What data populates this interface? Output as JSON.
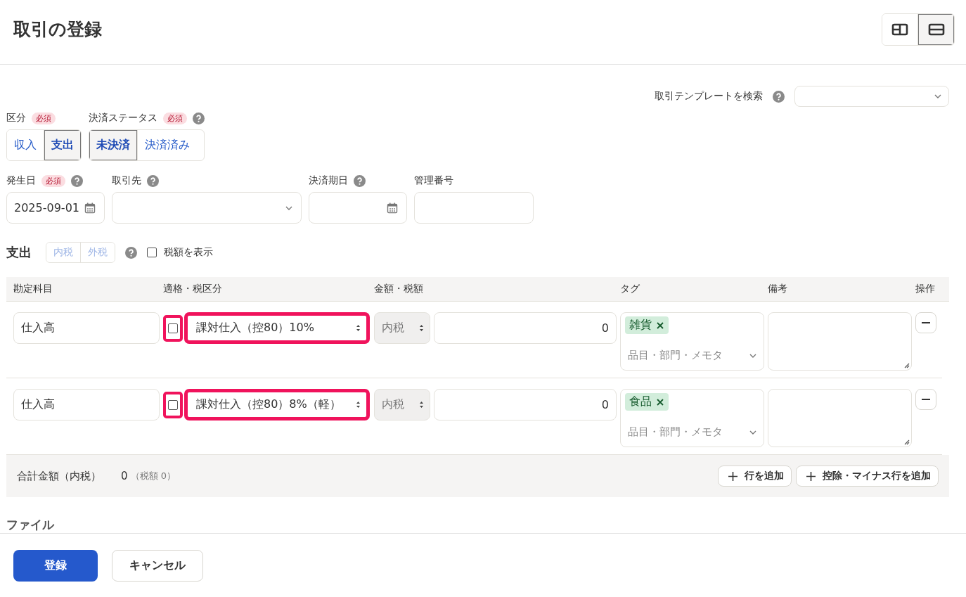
{
  "title": "取引の登録",
  "layout_toggle": [
    {
      "kind": "split",
      "selected": false
    },
    {
      "kind": "stacked",
      "selected": true
    }
  ],
  "template_search": {
    "label": "取引テンプレートを検索"
  },
  "category": {
    "label": "区分",
    "required": "必須",
    "options": [
      {
        "label": "収入",
        "selected": false
      },
      {
        "label": "支出",
        "selected": true
      }
    ]
  },
  "settlement": {
    "label": "決済ステータス",
    "required": "必須",
    "options": [
      {
        "label": "未決済",
        "selected": true
      },
      {
        "label": "決済済み",
        "selected": false
      }
    ]
  },
  "fields": [
    {
      "kind": "date",
      "label": "発生日",
      "required": "必須",
      "help": true,
      "value": "2025-09-01"
    },
    {
      "kind": "select",
      "label": "取引先",
      "help": true
    },
    {
      "kind": "date",
      "label": "決済期日",
      "help": true
    },
    {
      "kind": "text",
      "label": "管理番号",
      "help": false
    }
  ],
  "section": {
    "title": "支出",
    "tax_modes": [
      {
        "label": "内税",
        "disabled": true
      },
      {
        "label": "外税",
        "disabled": true
      }
    ],
    "show_tax": {
      "label": "税額を表示",
      "checked": false
    }
  },
  "table": {
    "columns": [
      "勘定科目",
      "適格・税区分",
      "金額・税額",
      "タグ",
      "備考",
      "操作"
    ],
    "rows": [
      {
        "account": "仕入高",
        "qualified": false,
        "tax_category": "課対仕入（控80）10%",
        "highlighted": true,
        "tax_mode": "内税",
        "amount": "0",
        "tag": "雑貨",
        "tag_placeholder": "品目・部門・メモタ"
      },
      {
        "account": "仕入高",
        "qualified": false,
        "tax_category": "課対仕入（控80）8%（軽）",
        "highlighted": true,
        "tax_mode": "内税",
        "amount": "0",
        "tag": "食品",
        "tag_placeholder": "品目・部門・メモタ"
      }
    ]
  },
  "total": {
    "label": "合計金額（内税）",
    "amount": "0",
    "tax": "（税額 0）"
  },
  "add_buttons": [
    "行を追加",
    "控除・マイナス行を追加"
  ],
  "files_heading": "ファイル",
  "footer": {
    "submit": "登録",
    "cancel": "キャンセル"
  }
}
